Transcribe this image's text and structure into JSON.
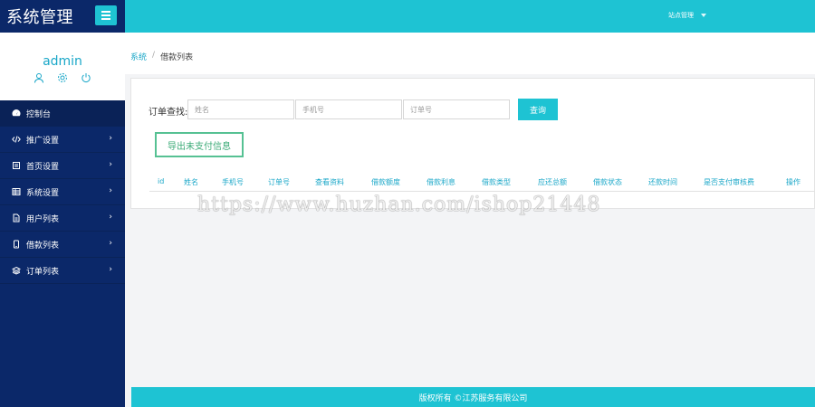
{
  "sidebar": {
    "brand": "系统管理",
    "profile_name": "admin",
    "items": [
      {
        "label": "控制台",
        "icon": "dashboard-icon",
        "has_children": false
      },
      {
        "label": "推广设置",
        "icon": "code-icon",
        "has_children": true
      },
      {
        "label": "首页设置",
        "icon": "home-icon",
        "has_children": true
      },
      {
        "label": "系统设置",
        "icon": "grid-icon",
        "has_children": true
      },
      {
        "label": "用户列表",
        "icon": "file-icon",
        "has_children": true
      },
      {
        "label": "借款列表",
        "icon": "tablet-icon",
        "has_children": true
      },
      {
        "label": "订单列表",
        "icon": "layers-icon",
        "has_children": true
      }
    ],
    "chevron": "›"
  },
  "topbar": {
    "user_menu": "站点管理"
  },
  "breadcrumb": {
    "root": "系统",
    "separator": "/",
    "current": "借款列表"
  },
  "search": {
    "label": "订单查找:",
    "name_placeholder": "姓名",
    "phone_placeholder": "手机号",
    "order_placeholder": "订单号",
    "search_button": "查询",
    "export_button": "导出未支付信息"
  },
  "table": {
    "columns": [
      "id",
      "姓名",
      "手机号",
      "订单号",
      "查看资料",
      "借款额度",
      "借款利息",
      "借款类型",
      "应还总额",
      "借款状态",
      "还款时间",
      "是否支付审核费",
      "操作"
    ]
  },
  "footer": {
    "text": "版权所有 ©江苏服务有限公司"
  },
  "watermark": {
    "text": "https://www.huzhan.com/ishop21448"
  },
  "colors": {
    "accent": "#1ec3d3",
    "sidebar": "#0b2869",
    "link": "#1aa7c8",
    "export_border": "#56c193"
  }
}
